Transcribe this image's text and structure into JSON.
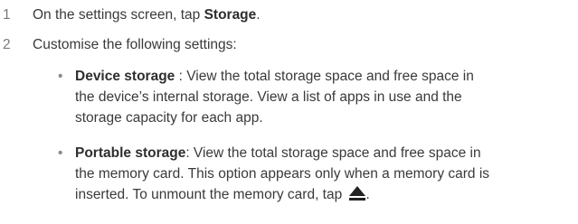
{
  "steps": [
    {
      "number": "1",
      "text_before": "On the settings screen, tap ",
      "bold": "Storage",
      "text_after": "."
    },
    {
      "number": "2",
      "text": "Customise the following settings:"
    }
  ],
  "bullets": [
    {
      "bullet_char": "•",
      "term": "Device storage",
      "line1_rest": " : View the total storage space and free space in",
      "line2": "the device’s internal storage. View a list of apps in use and the",
      "line3": "storage capacity for each app."
    },
    {
      "bullet_char": "•",
      "term": "Portable storage",
      "line1_rest": ": View the total storage space and free space in",
      "line2": "the memory card. This option appears only when a memory card is",
      "line3_before_icon": "inserted. To unmount the memory card, tap ",
      "icon": "eject-icon",
      "line3_after_icon": "."
    }
  ]
}
